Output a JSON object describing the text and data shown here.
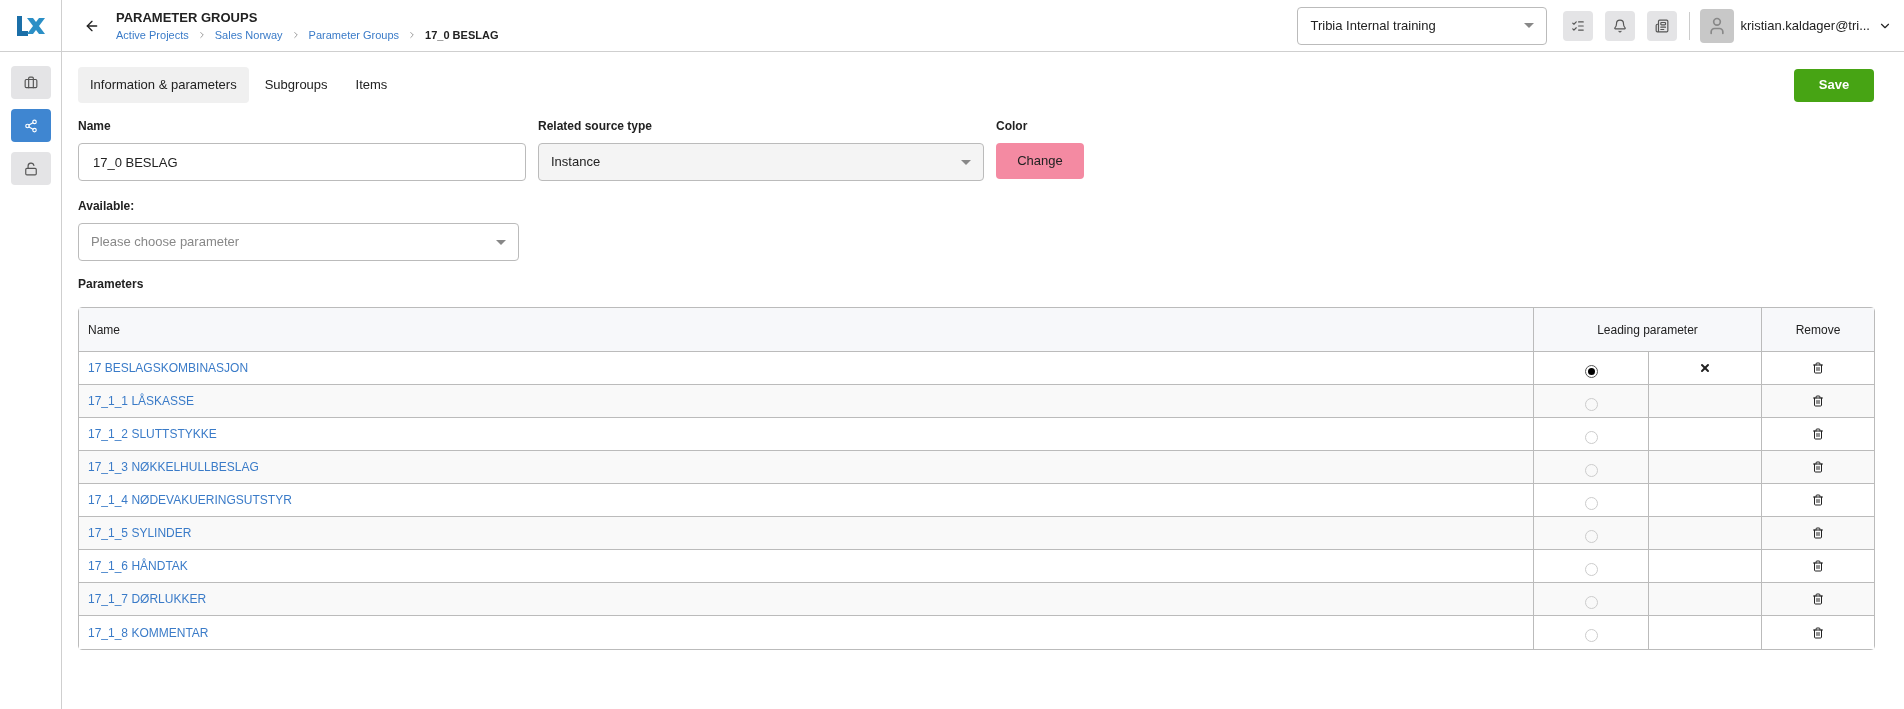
{
  "header": {
    "title": "PARAMETER GROUPS",
    "breadcrumbs": [
      {
        "label": "Active Projects",
        "current": false
      },
      {
        "label": "Sales Norway",
        "current": false
      },
      {
        "label": "Parameter Groups",
        "current": false
      },
      {
        "label": "17_0 BESLAG",
        "current": true
      }
    ],
    "project_select": "Tribia Internal training",
    "user": "kristian.kaldager@tri..."
  },
  "sidebar": {
    "items": [
      {
        "kind": "briefcase",
        "selected": false
      },
      {
        "kind": "network",
        "selected": true
      },
      {
        "kind": "lock",
        "selected": false
      }
    ]
  },
  "tabs": [
    {
      "label": "Information & parameters",
      "selected": true
    },
    {
      "label": "Subgroups",
      "selected": false
    },
    {
      "label": "Items",
      "selected": false
    }
  ],
  "save_button": "Save",
  "form": {
    "name_label": "Name",
    "name_value": "17_0 BESLAG",
    "source_label": "Related source type",
    "source_value": "Instance",
    "color_label": "Color",
    "color_button": "Change",
    "color": "#f48aa2",
    "available_label": "Available:",
    "available_placeholder": "Please choose parameter"
  },
  "parameters": {
    "title": "Parameters",
    "columns": [
      "Name",
      "Leading parameter",
      "Remove"
    ],
    "rows": [
      {
        "name": "17 BESLAGSKOMBINASJON",
        "leading": true
      },
      {
        "name": "17_1_1 LÅSKASSE",
        "leading": false
      },
      {
        "name": "17_1_2 SLUTTSTYKKE",
        "leading": false
      },
      {
        "name": "17_1_3 NØKKELHULLBESLAG",
        "leading": false
      },
      {
        "name": "17_1_4 NØDEVAKUERINGSUTSTYR",
        "leading": false
      },
      {
        "name": "17_1_5 SYLINDER",
        "leading": false
      },
      {
        "name": "17_1_6 HÅNDTAK",
        "leading": false
      },
      {
        "name": "17_1_7 DØRLUKKER",
        "leading": false
      },
      {
        "name": "17_1_8 KOMMENTAR",
        "leading": false
      }
    ]
  }
}
